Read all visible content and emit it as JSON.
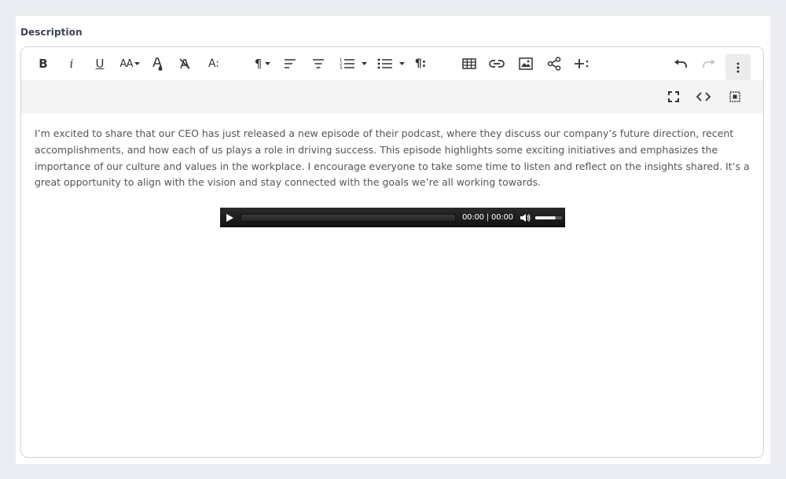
{
  "field": {
    "label": "Description"
  },
  "toolbar": {
    "bold": "B",
    "italic": "i",
    "underline": "U",
    "font_size": "AA",
    "paragraph_mark": "¶",
    "paragraph_format_mark": "¶:",
    "text_style": "A:"
  },
  "content": {
    "paragraph": "I’m excited to share that our CEO has just released a new episode of their podcast, where they discuss our company’s future direction, recent accomplishments, and how each of us plays a role in driving success. This episode highlights some exciting initiatives and emphasizes the importance of our culture and values in the workplace. I encourage everyone to take some time to listen and reflect on the insights shared. It’s a great opportunity to align with the vision and stay connected with the goals we’re all working towards."
  },
  "audio_player": {
    "time": "00:00 | 00:00",
    "progress": 0,
    "volume": 0.75
  }
}
